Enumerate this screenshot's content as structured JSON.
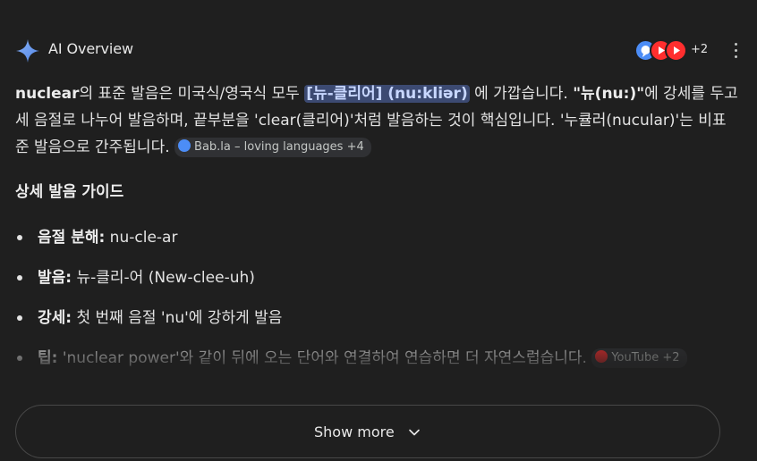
{
  "header": {
    "title": "AI Overview",
    "source_count": "+2",
    "more_icon": "more-vert-icon"
  },
  "intro": {
    "term": "nuclear",
    "t1": "의 표준 발음은 미국식/영국식 모두 ",
    "highlight": "[뉴-클리어] (nu:kliər)",
    "t2": " 에 가깝습니다. ",
    "stress": "\"뉴(nu:)\"",
    "t3": "에 강세를 두고 세 음절로 나누어 발음하며, 끝부분을 'clear(클리어)'처럼 발음하는 것이 핵심입니다. '누큘러(nucular)'는 비표준 발음으로 간주됩니다.",
    "chip": "Bab.la – loving languages +4"
  },
  "section": {
    "title": "상세 발음 가이드"
  },
  "bullets": [
    {
      "label": "음절 분해:",
      "text": " nu-cle-ar"
    },
    {
      "label": "발음:",
      "text": " 뉴-클리-어 (New-clee-uh)"
    },
    {
      "label": "강세:",
      "text": " 첫 번째 음절 'nu'에 강하게 발음"
    },
    {
      "label": "팁:",
      "text": " 'nuclear power'와 같이 뒤에 오는 단어와 연결하여 연습하면 더 자연스럽습니다.",
      "chip": "YouTube +2"
    }
  ],
  "footer": {
    "show_more": "Show more"
  },
  "colors": {
    "background": "#1f1f1f",
    "highlight_bg": "#3c4a72",
    "highlight_text": "#c8d7ff",
    "youtube": "#ff2e2e",
    "babla": "#4c8df6"
  }
}
